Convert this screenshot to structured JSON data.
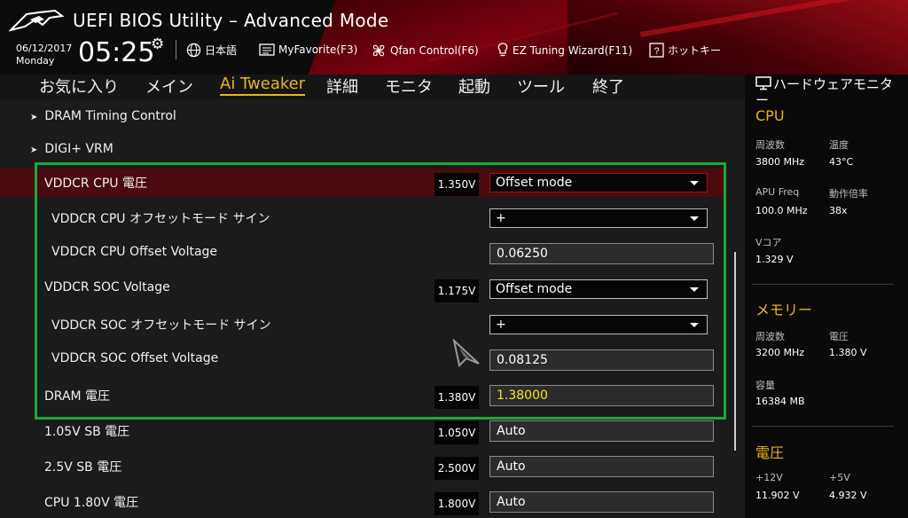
{
  "header": {
    "title": "UEFI BIOS Utility – Advanced Mode",
    "date": "06/12/2017",
    "day": "Monday",
    "time": "05:25",
    "buttons": [
      {
        "label": "日本語",
        "icon": "globe-icon"
      },
      {
        "label": "MyFavorite(F3)",
        "icon": "favorite-icon"
      },
      {
        "label": "Qfan Control(F6)",
        "icon": "fan-icon"
      },
      {
        "label": "EZ Tuning Wizard(F11)",
        "icon": "lightbulb-icon"
      },
      {
        "label": "ホットキー",
        "icon": "help-icon"
      }
    ]
  },
  "menu": {
    "items": [
      "お気に入り",
      "メイン",
      "Ai Tweaker",
      "詳細",
      "モニタ",
      "起動",
      "ツール",
      "終了"
    ],
    "active": "Ai Tweaker"
  },
  "main": {
    "submenus": [
      "DRAM Timing Control",
      "DIGI+ VRM"
    ],
    "rows": [
      {
        "label": "VDDCR CPU 電圧",
        "value": "1.350V",
        "control": "Offset mode"
      },
      {
        "label": "VDDCR CPU オフセットモード サイン",
        "control": "+"
      },
      {
        "label": "VDDCR CPU Offset Voltage",
        "control": "0.06250"
      },
      {
        "label": "VDDCR SOC Voltage",
        "value": "1.175V",
        "control": "Offset mode"
      },
      {
        "label": "VDDCR SOC オフセットモード サイン",
        "control": "+"
      },
      {
        "label": "VDDCR SOC Offset Voltage",
        "control": "0.08125"
      },
      {
        "label": "DRAM 電圧",
        "value": "1.380V",
        "control": "1.38000"
      },
      {
        "label": "1.05V SB 電圧",
        "value": "1.050V",
        "control": "Auto"
      },
      {
        "label": "2.5V SB 電圧",
        "value": "2.500V",
        "control": "Auto"
      },
      {
        "label": "CPU 1.80V 電圧",
        "value": "1.800V",
        "control": "Auto"
      }
    ]
  },
  "hw_monitor": {
    "title": "ハードウェアモニター",
    "cpu": {
      "section": "CPU",
      "freq_label": "周波数",
      "freq": "3800 MHz",
      "temp_label": "温度",
      "temp": "43°C",
      "apu_label": "APU Freq",
      "apu": "100.0 MHz",
      "ratio_label": "動作倍率",
      "ratio": "38x",
      "vcore_label": "Vコア",
      "vcore": "1.329 V"
    },
    "memory": {
      "section": "メモリー",
      "freq_label": "周波数",
      "freq": "3200 MHz",
      "volt_label": "電圧",
      "volt": "1.380 V",
      "cap_label": "容量",
      "cap": "16384 MB"
    },
    "voltage": {
      "section": "電圧",
      "v12_label": "+12V",
      "v12": "11.902 V",
      "v5_label": "+5V",
      "v5": "4.932 V"
    }
  },
  "colors": {
    "accent": "#e7b520",
    "highlight_row": "#4a0a0e",
    "annotation_box": "#1fa83c",
    "dram_value": "#f3e629"
  }
}
